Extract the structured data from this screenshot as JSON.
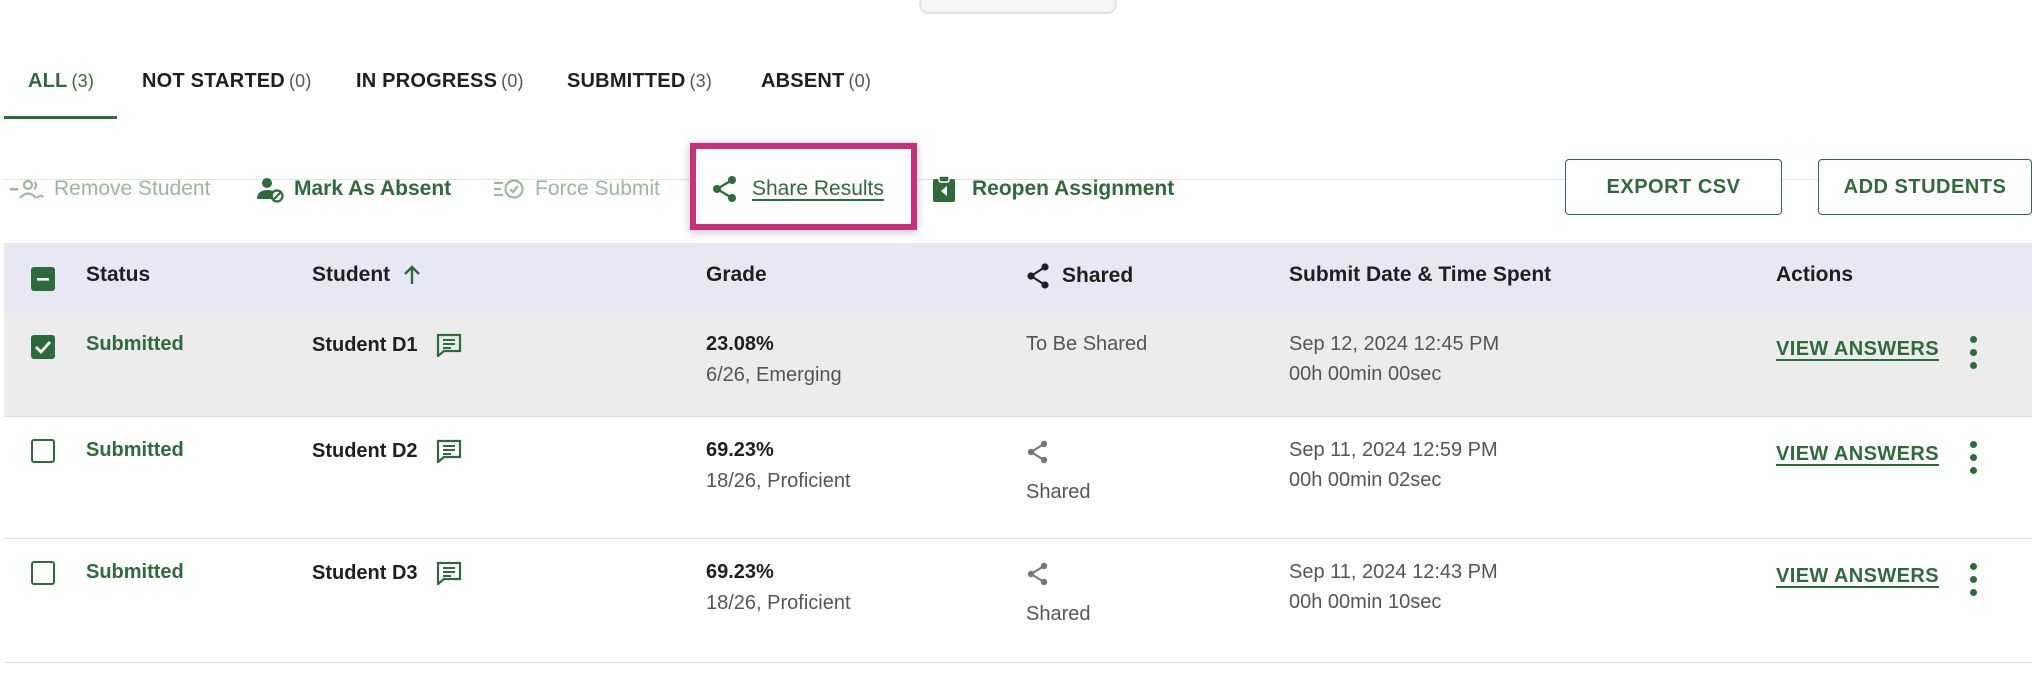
{
  "tabs": [
    {
      "label": "ALL",
      "count": "(3)"
    },
    {
      "label": "NOT STARTED",
      "count": "(0)"
    },
    {
      "label": "IN PROGRESS",
      "count": "(0)"
    },
    {
      "label": "SUBMITTED",
      "count": "(3)"
    },
    {
      "label": "ABSENT",
      "count": "(0)"
    }
  ],
  "toolbar": {
    "remove_student": "Remove Student",
    "mark_absent": "Mark As Absent",
    "force_submit": "Force Submit",
    "share_results": "Share Results",
    "reopen_assignment": "Reopen Assignment",
    "export_csv": "EXPORT CSV",
    "add_students": "ADD STUDENTS"
  },
  "columns": {
    "status": "Status",
    "student": "Student",
    "grade": "Grade",
    "shared": "Shared",
    "submit": "Submit Date & Time Spent",
    "actions": "Actions"
  },
  "rows": [
    {
      "selected": true,
      "status": "Submitted",
      "student": "Student D1",
      "grade_pct": "23.08%",
      "grade_sub": "6/26, Emerging",
      "shared": "To Be Shared",
      "date": "Sep 12, 2024 12:45 PM",
      "time_spent": "00h 00min 00sec",
      "action": "VIEW ANSWERS"
    },
    {
      "selected": false,
      "status": "Submitted",
      "student": "Student D2",
      "grade_pct": "69.23%",
      "grade_sub": "18/26, Proficient",
      "shared": "Shared",
      "date": "Sep 11, 2024 12:59 PM",
      "time_spent": "00h 00min 02sec",
      "action": "VIEW ANSWERS"
    },
    {
      "selected": false,
      "status": "Submitted",
      "student": "Student D3",
      "grade_pct": "69.23%",
      "grade_sub": "18/26, Proficient",
      "shared": "Shared",
      "date": "Sep 11, 2024 12:43 PM",
      "time_spent": "00h 00min 10sec",
      "action": "VIEW ANSWERS"
    }
  ],
  "colors": {
    "accent": "#2e6b3a",
    "highlight": "#c8307a",
    "header_bg": "#e8e8f4"
  }
}
